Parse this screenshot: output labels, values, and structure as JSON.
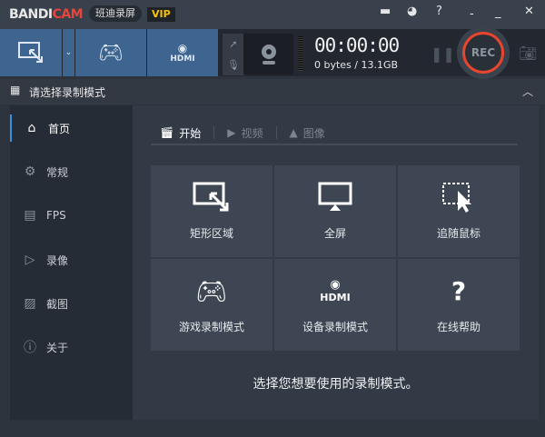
{
  "titlebar": {
    "logo_main": "BANDI",
    "logo_accent": "CAM",
    "cn_name": "班迪录屏",
    "vip": "VIP",
    "icons": [
      "folder-icon",
      "clock-icon",
      "help-icon",
      "minimize-tray-icon",
      "minimize-icon",
      "close-icon"
    ]
  },
  "toolbar": {
    "timer": "00:00:00",
    "size": "0 bytes / 13.1GB",
    "rec": "REC",
    "hdmi": "HDMI"
  },
  "modebar": {
    "title": "请选择录制模式"
  },
  "sidebar": {
    "items": [
      {
        "label": "首页",
        "icon": "home-icon"
      },
      {
        "label": "常规",
        "icon": "gear-icon"
      },
      {
        "label": "FPS",
        "icon": "fps-icon"
      },
      {
        "label": "录像",
        "icon": "video-settings-icon"
      },
      {
        "label": "截图",
        "icon": "image-settings-icon"
      },
      {
        "label": "关于",
        "icon": "info-icon"
      }
    ]
  },
  "tabs": [
    {
      "label": "开始"
    },
    {
      "label": "视频"
    },
    {
      "label": "图像"
    }
  ],
  "tiles": [
    {
      "label": "矩形区域"
    },
    {
      "label": "全屏"
    },
    {
      "label": "追随鼠标"
    },
    {
      "label": "游戏录制模式"
    },
    {
      "label": "设备录制模式"
    },
    {
      "label": "在线帮助"
    }
  ],
  "hint": "选择您想要使用的录制模式。"
}
